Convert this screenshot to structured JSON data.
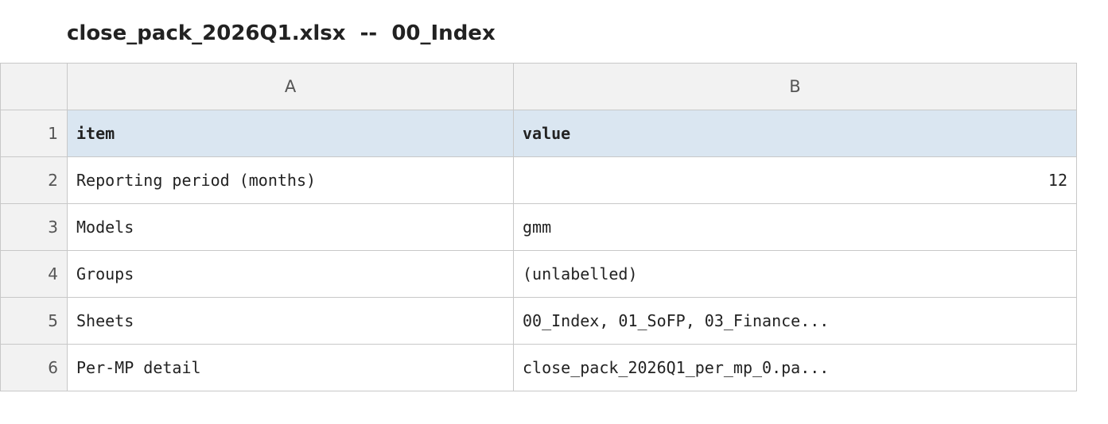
{
  "title": {
    "filename": "close_pack_2026Q1.xlsx",
    "separator": "  --  ",
    "sheet": "00_Index"
  },
  "grid": {
    "columns": [
      "A",
      "B"
    ],
    "rows": [
      {
        "num": "1",
        "a": "item",
        "b": "value"
      },
      {
        "num": "2",
        "a": "Reporting period (months)",
        "b": "12"
      },
      {
        "num": "3",
        "a": "Models",
        "b": "gmm"
      },
      {
        "num": "4",
        "a": "Groups",
        "b": "(unlabelled)"
      },
      {
        "num": "5",
        "a": "Sheets",
        "b": "00_Index, 01_SoFP, 03_Finance..."
      },
      {
        "num": "6",
        "a": "Per-MP detail",
        "b": "close_pack_2026Q1_per_mp_0.pa..."
      }
    ]
  },
  "colors": {
    "header_fill": "#dae6f1",
    "gutter_fill": "#f2f2f2",
    "border": "#c8c8c8"
  }
}
